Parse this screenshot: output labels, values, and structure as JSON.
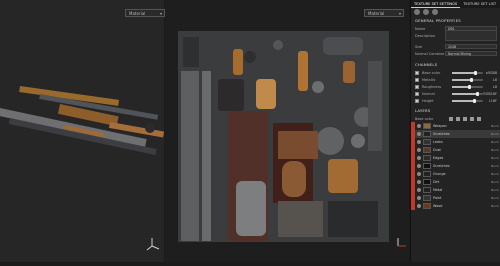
{
  "viewport_3d": {
    "material_dropdown": "Material"
  },
  "viewport_2d": {
    "left_dropdown": "Material",
    "right_dropdown": "Material"
  },
  "panel": {
    "tabs": [
      "TEXTURE SET SETTINGS",
      "TEXTURE SET LIST"
    ],
    "general_title": "GENERAL PROPERTIES",
    "name_label": "Name",
    "name_value": "DB1",
    "description_label": "Description",
    "description_value": "",
    "size_label": "Size",
    "size_value": "2048",
    "normal_mixing_label": "Normal Combine",
    "normal_mixing_value": "Normal Mixing",
    "channels_title": "CHANNELS",
    "channels": [
      {
        "label": "Base color",
        "value": "sRGB8",
        "fill": 0.75
      },
      {
        "label": "Metallic",
        "value": "L8",
        "fill": 0.6
      },
      {
        "label": "Roughness",
        "value": "L8",
        "fill": 0.55
      },
      {
        "label": "Normal",
        "value": "RGB16F",
        "fill": 0.8
      },
      {
        "label": "Height",
        "value": "L16F",
        "fill": 0.7
      }
    ],
    "layers_title": "LAYERS",
    "layers_header": "Base color",
    "layers": [
      {
        "name": "Weapon",
        "blend": "Norm",
        "thumb": "#8a6a3a",
        "selected": false
      },
      {
        "name": "Scratches",
        "blend": "Norm",
        "thumb": "#222",
        "selected": true
      },
      {
        "name": "Leaks",
        "blend": "Norm",
        "thumb": "#333",
        "selected": false
      },
      {
        "name": "Dust",
        "blend": "Norm",
        "thumb": "#5a3a25",
        "selected": false
      },
      {
        "name": "Edges",
        "blend": "Norm",
        "thumb": "#2a2a2a",
        "selected": false
      },
      {
        "name": "Scratches",
        "blend": "Norm",
        "thumb": "#111",
        "selected": false
      },
      {
        "name": "Grunge",
        "blend": "Norm",
        "thumb": "#222",
        "selected": false
      },
      {
        "name": "Dirt",
        "blend": "Norm",
        "thumb": "#111",
        "selected": false
      },
      {
        "name": "Metal",
        "blend": "Norm",
        "thumb": "#222",
        "selected": false
      },
      {
        "name": "Paint",
        "blend": "Norm",
        "thumb": "#333",
        "selected": false
      },
      {
        "name": "Wood",
        "blend": "Norm",
        "thumb": "#6b3a1e",
        "selected": false
      }
    ]
  }
}
